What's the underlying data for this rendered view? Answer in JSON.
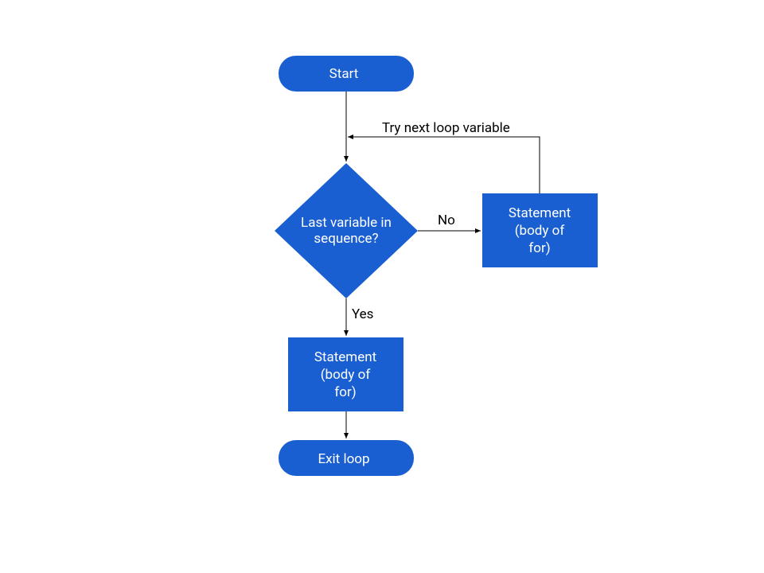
{
  "diagram": {
    "type": "flowchart",
    "description": "For loop flowchart",
    "nodes": {
      "start": {
        "label": "Start",
        "shape": "terminal"
      },
      "decision": {
        "label_line1": "Last variable in",
        "label_line2": "sequence?",
        "shape": "diamond"
      },
      "body_right": {
        "label_line1": "Statement",
        "label_line2": "(body of",
        "label_line3": "for)",
        "shape": "process"
      },
      "body_bottom": {
        "label_line1": "Statement",
        "label_line2": "(body of",
        "label_line3": "for)",
        "shape": "process"
      },
      "exit": {
        "label": "Exit loop",
        "shape": "terminal"
      }
    },
    "edges": {
      "decision_no": {
        "label": "No"
      },
      "decision_yes": {
        "label": "Yes"
      },
      "loopback": {
        "label": "Try next loop variable"
      }
    },
    "colors": {
      "fill": "#1a5fd1",
      "stroke": "#000000",
      "text": "#ffffff",
      "label": "#000000"
    }
  }
}
